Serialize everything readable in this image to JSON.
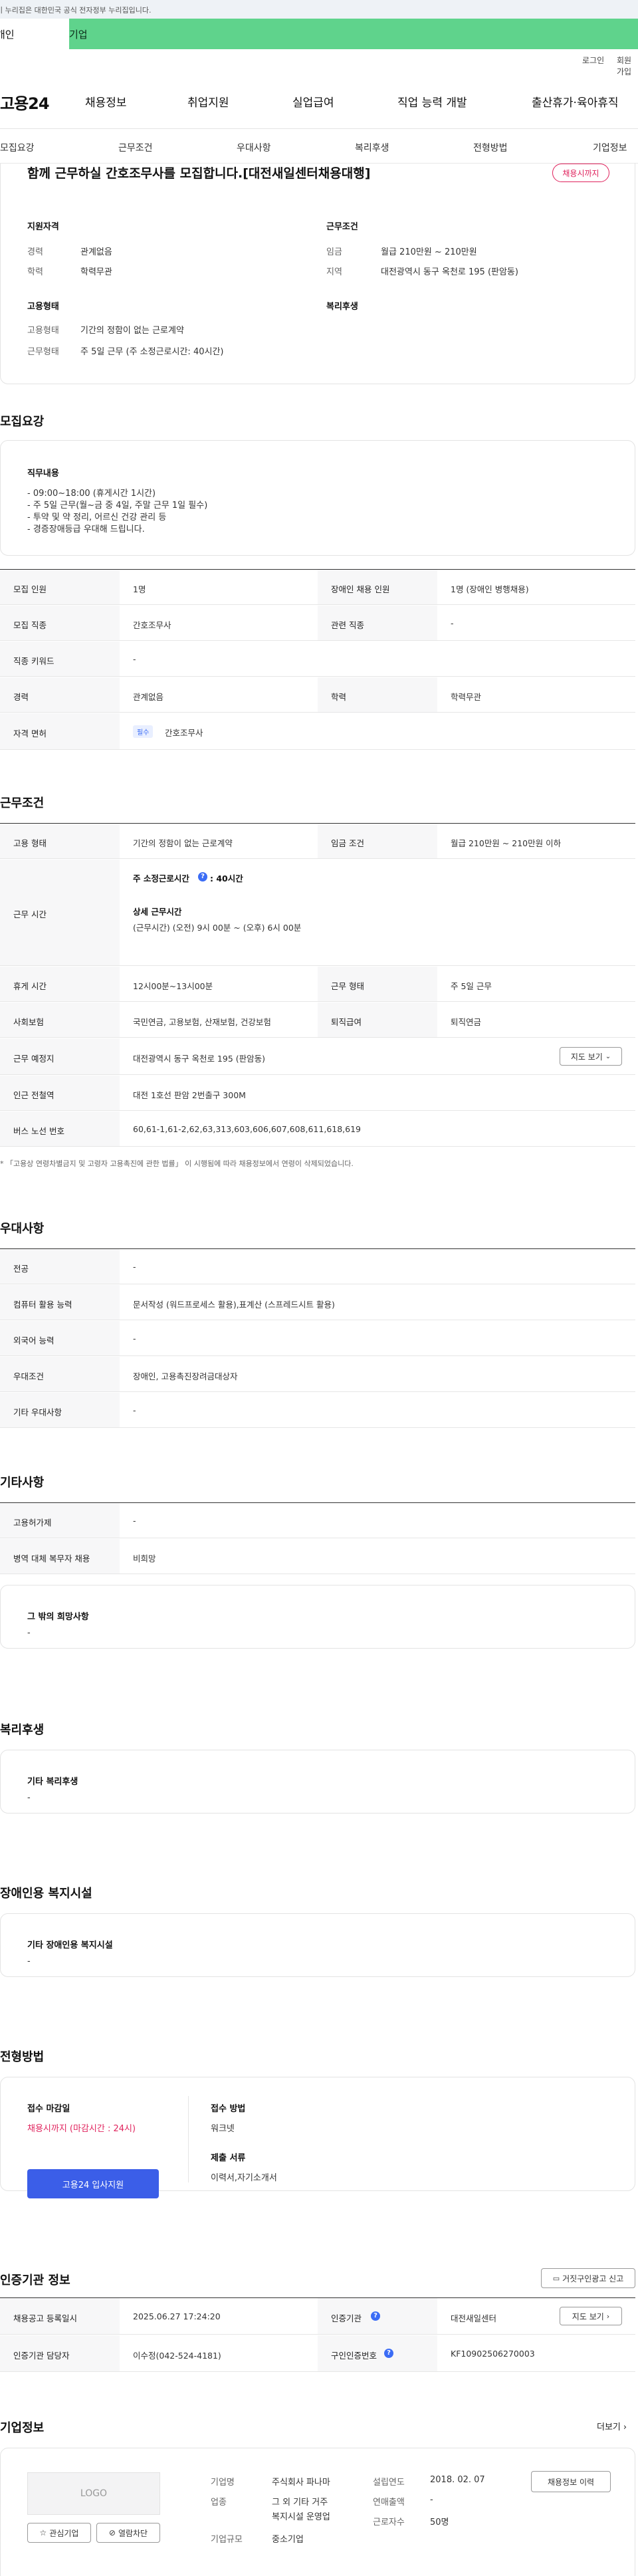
{
  "gov_banner": "이 누리집은 대한민국 공식 전자정부 누리집입니다.",
  "tabs": {
    "personal": "개인",
    "company": "기업"
  },
  "util": {
    "login": "로그인",
    "signup": "회원가입"
  },
  "gnb": {
    "logo": "고용24",
    "menu": [
      "채용정보",
      "취업지원",
      "실업급여",
      "직업 능력 개발",
      "출산휴가·육아휴직"
    ]
  },
  "snb": [
    "모집요강",
    "근무조건",
    "우대사항",
    "복리후생",
    "전형방법",
    "기업정보"
  ],
  "summary": {
    "title": "함께 근무하실 간호조무사를 모집합니다.[대전새일센터채용대행]",
    "badge": "채용시까지",
    "qual_title": "지원자격",
    "career_lbl": "경력",
    "career_val": "관계없음",
    "edu_lbl": "학력",
    "edu_val": "학력무관",
    "cond_title": "근무조건",
    "wage_lbl": "임금",
    "wage_val": "월급 210만원 ~ 210만원",
    "loc_lbl": "지역",
    "loc_val": "대전광역시 동구 옥천로 195 (판암동)",
    "emp_title": "고용형태",
    "emptype_lbl": "고용형태",
    "emptype_val": "기간의 정함이 없는 근로계약",
    "workshape_lbl": "근무형태",
    "workshape_val": "주 5일 근무 (주 소정근로시간: 40시간)",
    "welfare_title": "복리후생"
  },
  "recruit": {
    "title": "모집요강",
    "duty_title": "직무내용",
    "duty_lines": [
      "- 09:00~18:00 (휴게시간 1시간)",
      "- 주 5일 근무(월~금 중 4일, 주말 근무 1일 필수)",
      "- 투약 및 약 정리, 어르신 건강 관리 등",
      "- 경증장애등급 우대해 드립니다."
    ],
    "people_lbl": "모집 인원",
    "people_val": "1명",
    "disabled_lbl": "장애인 채용 인원",
    "disabled_val": "1명 (장애인 병행채용)",
    "job_lbl": "모집 직종",
    "job_val": "간호조무사",
    "rel_lbl": "관련 직종",
    "rel_val": "-",
    "kw_lbl": "직종 키워드",
    "kw_val": "-",
    "career_lbl": "경력",
    "career_val": "관계없음",
    "edu_lbl": "학력",
    "edu_val": "학력무관",
    "license_lbl": "자격 면허",
    "license_tag": "필수",
    "license_val": "간호조무사"
  },
  "work": {
    "title": "근무조건",
    "type_lbl": "고용 형태",
    "type_val": "기간의 정함이 없는 근로계약",
    "wage_lbl": "임금 조건",
    "wage_val": "월급 210만원 ~ 210만원 이하",
    "time_lbl": "근무 시간",
    "std_lbl": "주 소정근로시간",
    "std_val": ": 40시간",
    "detail_lbl": "상세 근무시간",
    "detail_val": "(근무시간) (오전) 9시 00분 ~ (오후) 6시 00분",
    "rest_lbl": "휴게 시간",
    "rest_val": "12시00분~13시00분",
    "shape_lbl": "근무 형태",
    "shape_val": "주 5일 근무",
    "ins_lbl": "사회보험",
    "ins_val": "국민연금, 고용보험, 산재보험, 건강보험",
    "ret_lbl": "퇴직급여",
    "ret_val": "퇴직연금",
    "place_lbl": "근무 예정지",
    "place_val": "대전광역시 동구 옥천로 195 (판암동)",
    "map_btn": "지도 보기",
    "subway_lbl": "인근 전철역",
    "subway_val": "대전 1호선 판암 2번출구 300M",
    "bus_lbl": "버스 노선 번호",
    "bus_val": "60,61-1,61-2,62,63,313,603,606,607,608,611,618,619",
    "note": "「고용상 연령차별금지 및 고령자 고용촉진에 관한 법률」 이 시행됨에 따라 채용정보에서 연령이 삭제되었습니다."
  },
  "prefer": {
    "title": "우대사항",
    "major_lbl": "전공",
    "major_val": "-",
    "pc_lbl": "컴퓨터 활용 능력",
    "pc_val": "문서작성 (워드프로세스 활용),표계산 (스프레드시트 활용)",
    "lang_lbl": "외국어 능력",
    "lang_val": "-",
    "cond_lbl": "우대조건",
    "cond_val": "장애인, 고용촉진장려금대상자",
    "etc_lbl": "기타 우대사항",
    "etc_val": "-"
  },
  "other": {
    "title": "기타사항",
    "hire_lbl": "고용허가제",
    "hire_val": "-",
    "mil_lbl": "병역 대체 복무자 채용",
    "mil_val": "비희망",
    "wish_title": "그 밖의 희망사항",
    "wish_val": "-"
  },
  "welfare": {
    "title": "복리후생",
    "box_title": "기타 복리후생",
    "box_val": "-"
  },
  "disabled_fac": {
    "title": "장애인용 복지시설",
    "box_title": "기타 장애인용 복지시설",
    "box_val": "-"
  },
  "apply": {
    "title": "전형방법",
    "deadline_lbl": "접수 마감일",
    "deadline_val": "채용시까지 (마감시간 : 24시)",
    "method_lbl": "접수 방법",
    "method_val": "워크넷",
    "doc_lbl": "제출 서류",
    "doc_val": "이력서,자기소개서",
    "apply_btn": "고용24 입사지원"
  },
  "agency": {
    "title": "인증기관 정보",
    "report_btn": "거짓구인광고 신고",
    "reg_lbl": "채용공고 등록일시",
    "reg_val": "2025.06.27 17:24:20",
    "cert_lbl": "인증기관",
    "cert_val": "대전새일센터",
    "map_btn": "지도 보기",
    "mgr_lbl": "인증기관 담당자",
    "mgr_val": "이수정(042-524-4181)",
    "num_lbl": "구인인증번호",
    "num_val": "KF10902506270003"
  },
  "company": {
    "title": "기업정보",
    "more": "더보기",
    "logo": "LOGO",
    "fav_btn": "관심기업",
    "block_btn": "열람차단",
    "name_lbl": "기업명",
    "name_val": "주식회사 파나마",
    "ind_lbl": "업종",
    "ind_val1": "그 외 기타 거주",
    "ind_val2": "복지시설 운영업",
    "size_lbl": "기업규모",
    "size_val": "중소기업",
    "est_lbl": "설립연도",
    "est_val": "2018. 02. 07",
    "sales_lbl": "연매출액",
    "sales_val": "-",
    "emp_lbl": "근로자수",
    "emp_val": "50명",
    "history_btn": "채용정보 이력"
  },
  "colors": {
    "accent": "#5fd38c",
    "primary": "#3b5ee8",
    "danger": "#e0245e",
    "blue": "#3b6cf5"
  }
}
